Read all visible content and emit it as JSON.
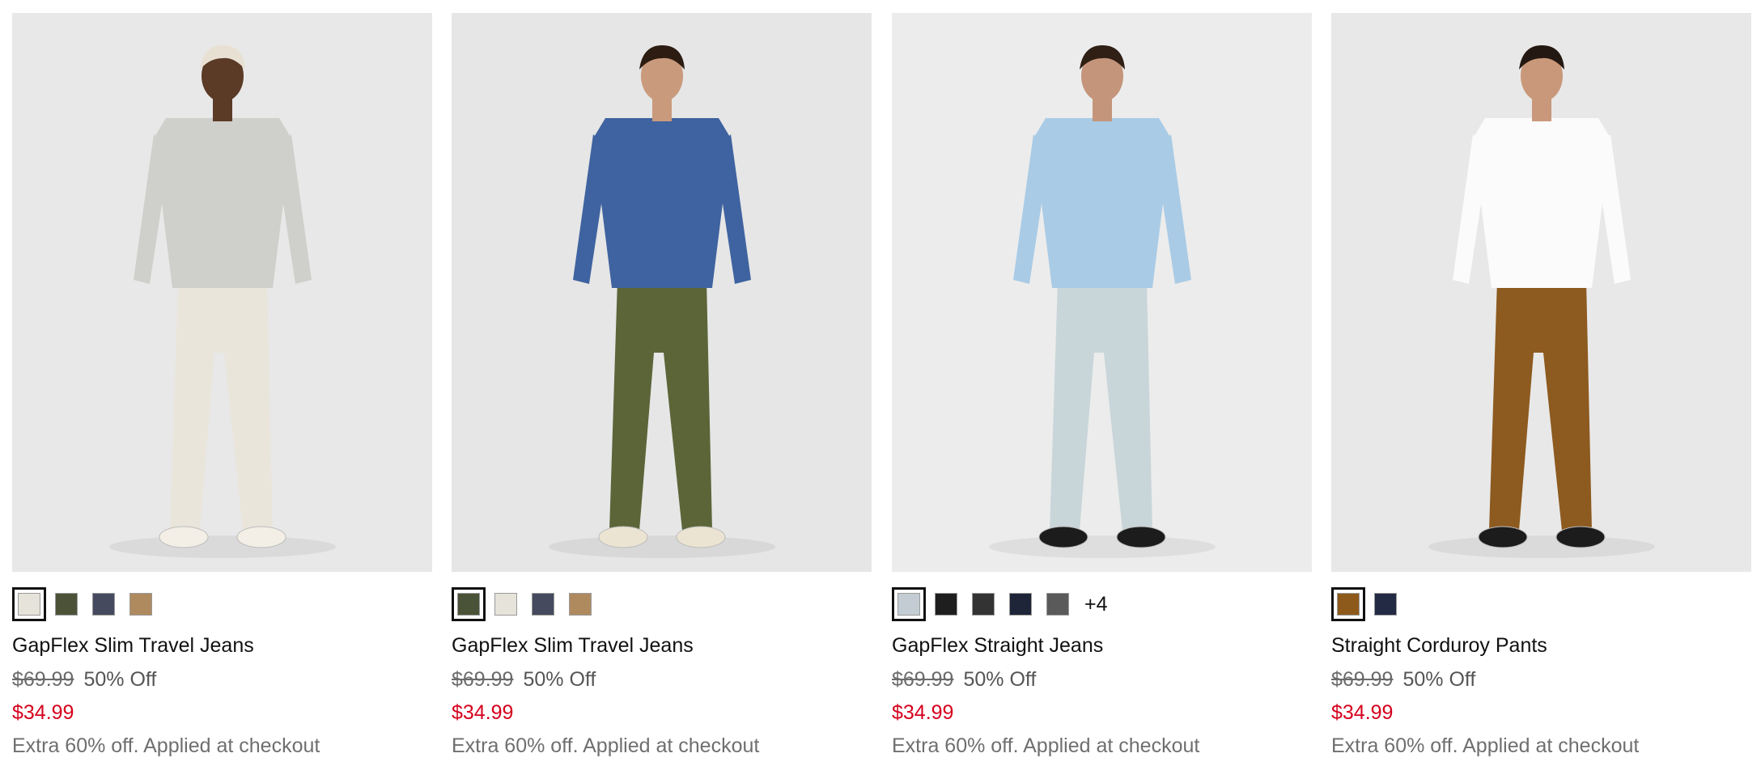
{
  "products": [
    {
      "name": "GapFlex Slim Travel Jeans",
      "original_price": "$69.99",
      "discount": "50% Off",
      "sale_price": "$34.99",
      "promo": "Extra 60% off. Applied at checkout",
      "swatches": [
        "#e6e3da",
        "#4b5238",
        "#454a5e",
        "#b08a5f"
      ],
      "selected_swatch": 0,
      "more": "",
      "colors": {
        "bg": "#e8e8e8",
        "skin": "#5b3a26",
        "top": "#cfcfcb",
        "pants": "#e9e5db",
        "shoes": "#f3efe6",
        "hair": "#e8e0d2"
      }
    },
    {
      "name": "GapFlex Slim Travel Jeans",
      "original_price": "$69.99",
      "discount": "50% Off",
      "sale_price": "$34.99",
      "promo": "Extra 60% off. Applied at checkout",
      "swatches": [
        "#4a5237",
        "#e6e3da",
        "#454a5e",
        "#b08a5f"
      ],
      "selected_swatch": 0,
      "more": "",
      "colors": {
        "bg": "#e6e6e6",
        "skin": "#c99a7c",
        "top": "#3f63a0",
        "pants": "#5b6538",
        "shoes": "#ece4d2",
        "hair": "#2c1c12"
      }
    },
    {
      "name": "GapFlex Straight Jeans",
      "original_price": "$69.99",
      "discount": "50% Off",
      "sale_price": "$34.99",
      "promo": "Extra 60% off. Applied at checkout",
      "swatches": [
        "#c3ccd3",
        "#1e1e1e",
        "#333333",
        "#1f2538",
        "#5a5a5a"
      ],
      "selected_swatch": 0,
      "more": "+4",
      "colors": {
        "bg": "#ececec",
        "skin": "#c4957a",
        "top": "#a9cbe6",
        "pants": "#c9d6d9",
        "shoes": "#1c1c1c",
        "hair": "#2f1f14"
      }
    },
    {
      "name": "Straight Corduroy Pants",
      "original_price": "$69.99",
      "discount": "50% Off",
      "sale_price": "$34.99",
      "promo": "Extra 60% off. Applied at checkout",
      "swatches": [
        "#8e5a1c",
        "#232a44"
      ],
      "selected_swatch": 0,
      "more": "",
      "colors": {
        "bg": "#e8e8e8",
        "skin": "#c9987a",
        "top": "#fbfbfb",
        "pants": "#8d5a1f",
        "shoes": "#1c1c1c",
        "hair": "#241812"
      }
    }
  ]
}
